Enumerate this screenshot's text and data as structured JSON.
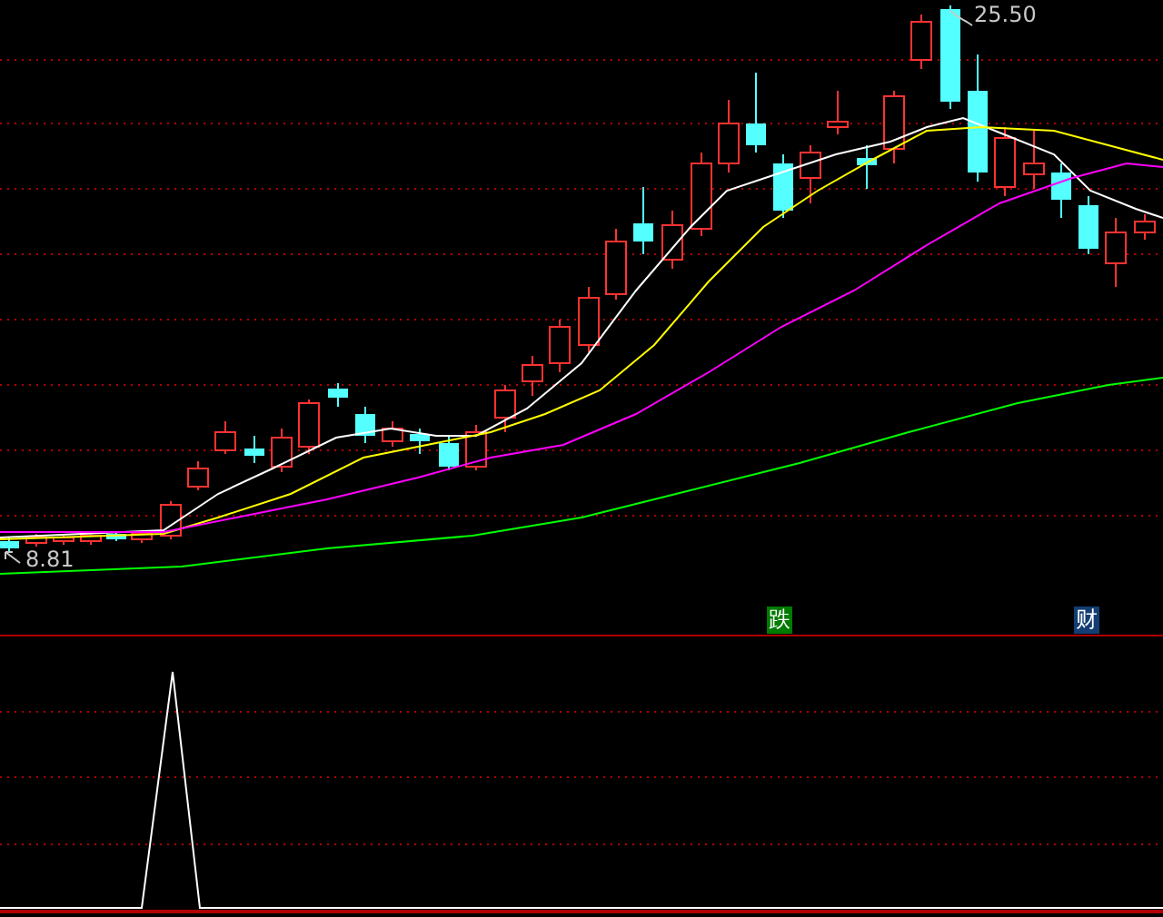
{
  "price_labels": [
    {
      "text": "25.50"
    },
    {
      "text": "8.81"
    }
  ],
  "markers": [
    {
      "text": "跌",
      "color": "#007a00"
    },
    {
      "text": "财",
      "color": "#133d73"
    }
  ]
}
